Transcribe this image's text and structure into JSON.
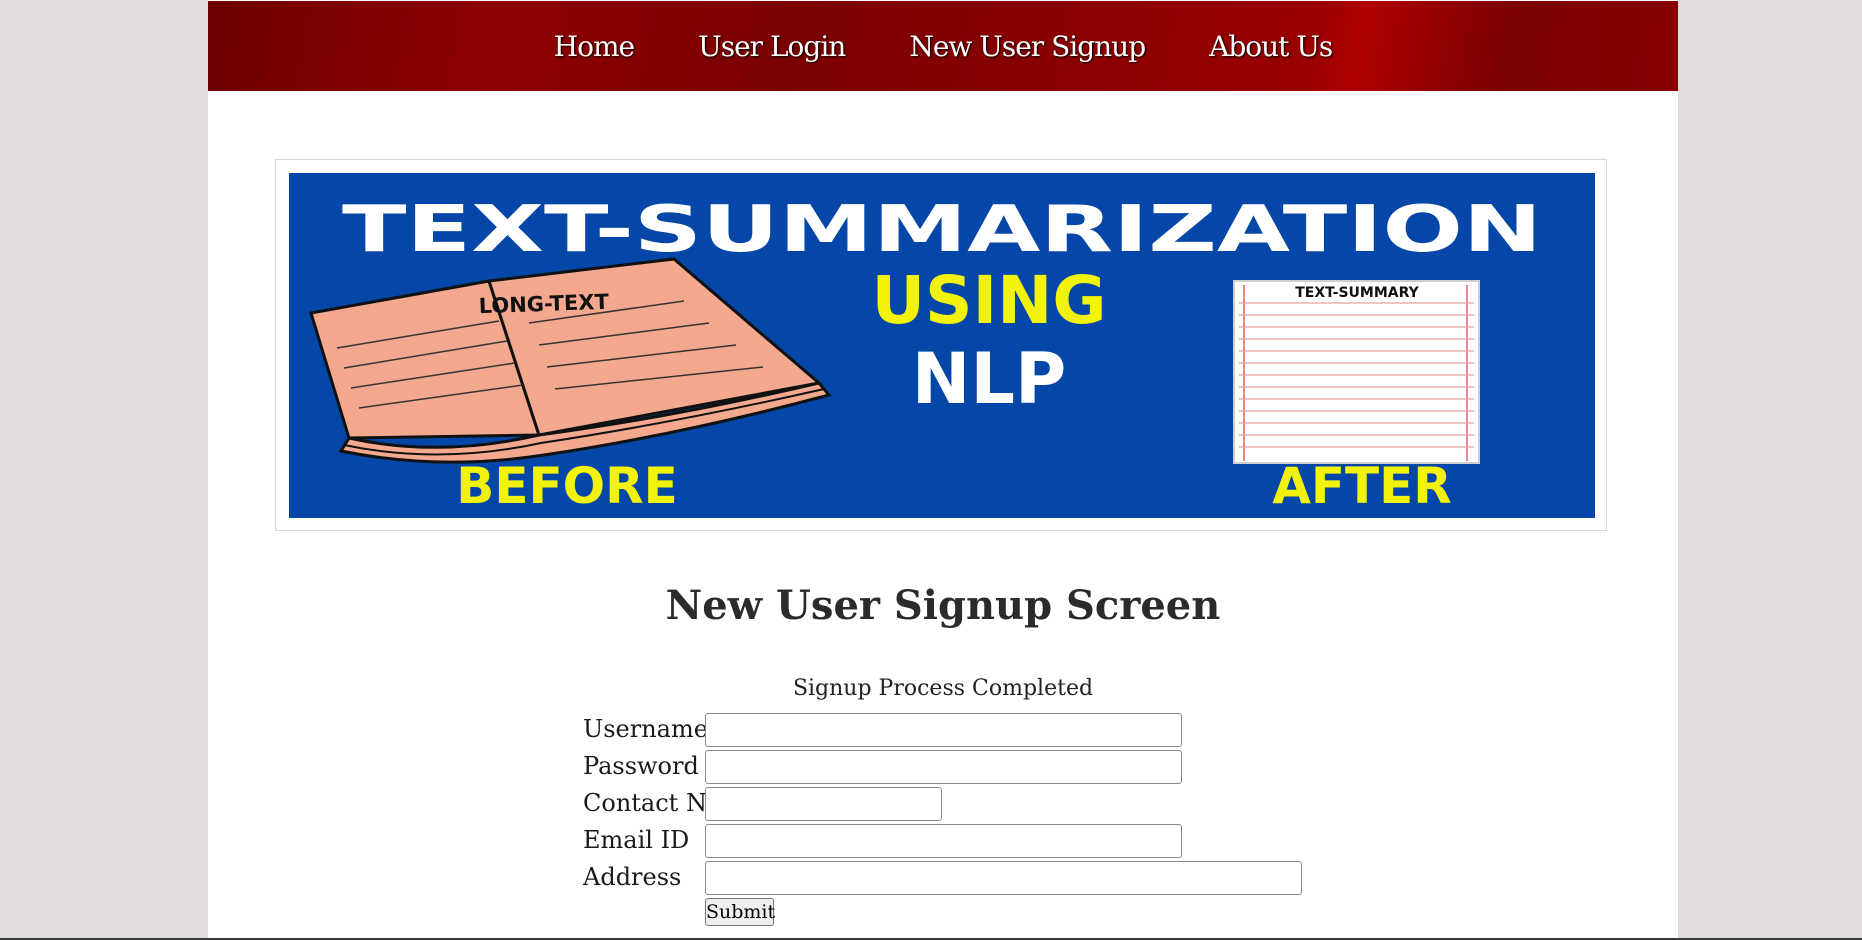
{
  "nav": {
    "items": [
      {
        "label": "Home"
      },
      {
        "label": "User Login"
      },
      {
        "label": "New User Signup"
      },
      {
        "label": "About Us"
      }
    ]
  },
  "banner": {
    "title": "TEXT-SUMMARIZATION",
    "using": "USING",
    "nlp": "NLP",
    "book_label": "LONG-TEXT",
    "summary_label": "TEXT-SUMMARY",
    "before": "BEFORE",
    "after": "AFTER",
    "colors": {
      "background": "#0447a8",
      "yellow": "#f2f20a",
      "white": "#ffffff",
      "book": "#f4a98f"
    }
  },
  "main": {
    "heading": "New User Signup Screen",
    "status": "Signup Process Completed",
    "fields": {
      "username": {
        "label": "Username",
        "value": ""
      },
      "password": {
        "label": "Password",
        "value": ""
      },
      "contact": {
        "label": "Contact No",
        "value": ""
      },
      "email": {
        "label": "Email ID",
        "value": ""
      },
      "address": {
        "label": "Address",
        "value": ""
      }
    },
    "submit_label": "Submit"
  },
  "colors": {
    "nav_red": "#8f0000",
    "page_bg": "#e0dcdb"
  }
}
